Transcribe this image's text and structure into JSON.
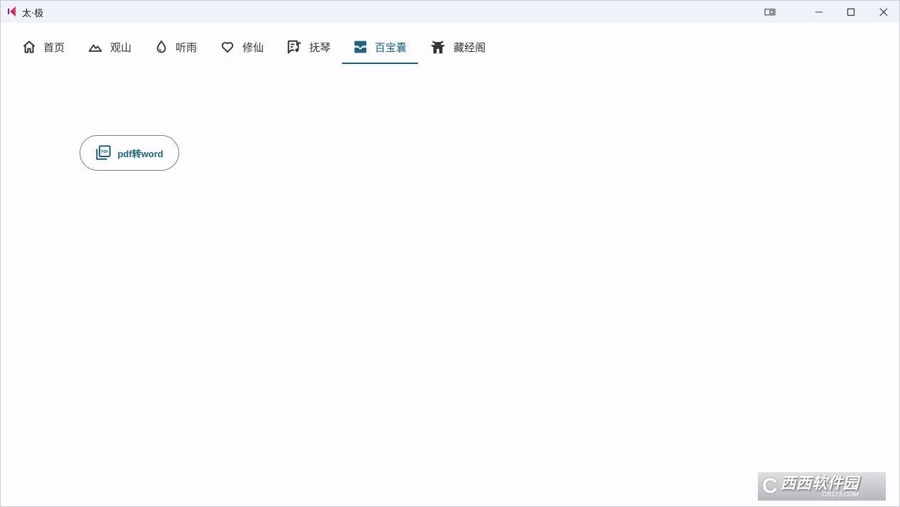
{
  "window": {
    "title": "太·极",
    "controls": [
      "pin-icon",
      "minimize-icon",
      "maximize-icon",
      "close-icon"
    ]
  },
  "tabs": [
    {
      "label": "首页",
      "icon": "home-icon"
    },
    {
      "label": "观山",
      "icon": "mountain-icon"
    },
    {
      "label": "听雨",
      "icon": "water-drop-icon"
    },
    {
      "label": "修仙",
      "icon": "heart-icon"
    },
    {
      "label": "抚琴",
      "icon": "music-note-icon"
    },
    {
      "label": "百宝囊",
      "icon": "inbox-tray-icon",
      "active": true
    },
    {
      "label": "藏经阁",
      "icon": "temple-icon"
    }
  ],
  "content": {
    "pdf_button_label": "pdf转word",
    "pdf_button_icon": "pdf-icon"
  },
  "watermark": {
    "text": "西西软件园",
    "sub": "CR173.COM"
  },
  "colors": {
    "accent": "#1e6178",
    "titlebar": "#eff2f8",
    "background": "#fdfcff",
    "logo": "#e8356d"
  }
}
